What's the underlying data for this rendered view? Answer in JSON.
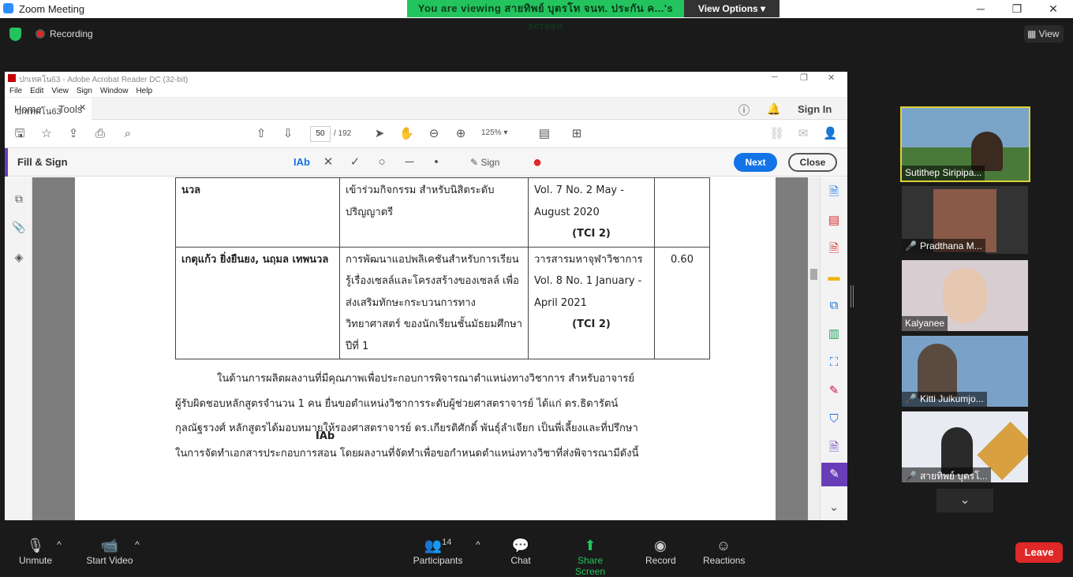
{
  "zoom": {
    "title": "Zoom Meeting",
    "viewing": "You are viewing สายทิพย์ บุตรโท จนท. ประกัน ค...'s screen",
    "view_options": "View Options",
    "recording": "Recording",
    "view": "View",
    "minimize": "─",
    "maximize": "❐",
    "close": "✕"
  },
  "acrobat": {
    "title": "ปกเทคโน63 - Adobe Acrobat Reader DC (32-bit)",
    "menu": [
      "File",
      "Edit",
      "View",
      "Sign",
      "Window",
      "Help"
    ],
    "tabs": {
      "home": "Home",
      "tools": "Tools",
      "doc": "ปกเทคโน63",
      "sign_in": "Sign In"
    },
    "page_current": "50",
    "page_total": "/ 192",
    "zoom": "125%",
    "fill_sign": "Fill & Sign",
    "sign": "Sign",
    "next": "Next",
    "close": "Close"
  },
  "document": {
    "rows": [
      {
        "c1": "นวล",
        "c2": "เข้าร่วมกิจกรรม สำหรับนิสิตระดับ ปริญญาตรี",
        "c3a": "Vol. 7 No. 2 May - August 2020",
        "c3b": "(TCI 2)",
        "c4": ""
      },
      {
        "c1": "เกตุแก้ว ยิ่งยืนยง, นฤมล เทพนวล",
        "c2": "การพัฒนาแอปพลิเคชันสำหรับการเรียนรู้เรื่องเซลล์และโครงสร้างของเซลล์ เพื่อส่งเสริมทักษะกระบวนการทางวิทยาศาสตร์ ของนักเรียนชั้นมัธยมศึกษาปีที่ 1",
        "c3a": "วารสารมหาจุฬาวิชาการ Vol. 8 No. 1 January - April 2021",
        "c3b": "(TCI 2)",
        "c4": "0.60"
      }
    ],
    "paragraph": [
      "ในด้านการผลิตผลงานที่มีคุณภาพเพื่อประกอบการพิจารณาตำแหน่งทางวิชาการ สำหรับอาจารย์",
      "ผู้รับผิดชอบหลักสูตรจำนวน 1 คน ยื่นขอตำแหน่งวิชาการระดับผู้ช่วยศาสตราจารย์  ได้แก่ ดร.ธิดารัตน์",
      "กุลณัฐรวงศ์ หลักสูตรได้มอบหมายให้รองศาสตราจารย์ ดร.เกียรติศักดิ์  พันธุ์ลำเจียก เป็นพี่เลี้ยงและที่ปรึกษา",
      "ในการจัดทำเอกสารประกอบการสอน โดยผลงานที่จัดทำเพื่อขอกำหนดตำแหน่งทางวิชาที่ส่งพิจารณามีดังนี้"
    ],
    "cursor_label": "IAb"
  },
  "participants": [
    "Sutithep Siripipa...",
    "Pradthana M...",
    "Kalyanee",
    "Kitti Juikumjo...",
    "สายทิพย์ บุตรโ..."
  ],
  "bottom": {
    "unmute": "Unmute",
    "start_video": "Start Video",
    "participants": "Participants",
    "participants_count": "14",
    "chat": "Chat",
    "share": "Share Screen",
    "record": "Record",
    "reactions": "Reactions",
    "leave": "Leave"
  },
  "colors": {
    "zoom_green": "#23c45e",
    "acrobat_blue": "#1473e6",
    "leave_red": "#e02828",
    "fill_sign_purple": "#6a3db8"
  }
}
